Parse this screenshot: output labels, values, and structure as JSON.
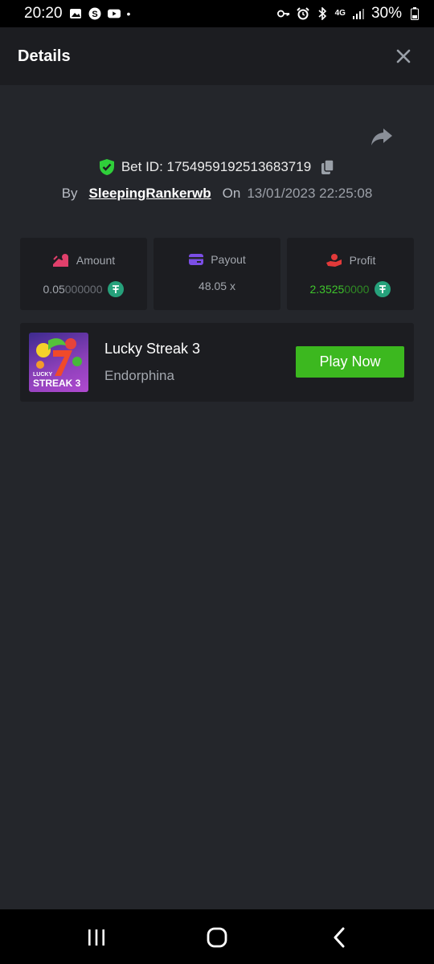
{
  "status_bar": {
    "time": "20:20",
    "network": "4G",
    "battery": "30%",
    "dot": "•"
  },
  "header": {
    "title": "Details"
  },
  "bet": {
    "id_label": "Bet ID: 1754959192513683719",
    "by_label": "By",
    "user": "SleepingRankerwb",
    "on_label": "On",
    "date": "13/01/2023 22:25:08"
  },
  "stats": {
    "amount": {
      "label": "Amount",
      "value_main": "0.05",
      "value_dim": "000000",
      "icon_color": "#e0406b"
    },
    "payout": {
      "label": "Payout",
      "value": "48.05 x",
      "icon_color": "#7b4ee6"
    },
    "profit": {
      "label": "Profit",
      "value_main": "2.3525",
      "value_dim": "0000",
      "icon_color": "#e23a3a"
    }
  },
  "game": {
    "name": "Lucky Streak 3",
    "provider": "Endorphina",
    "play_label": "Play Now",
    "thumb_line1": "LUCKY",
    "thumb_line2": "STREAK 3"
  },
  "colors": {
    "accent_green": "#3cb81f",
    "coin": "#26a17b",
    "shield": "#2fcf3a"
  }
}
